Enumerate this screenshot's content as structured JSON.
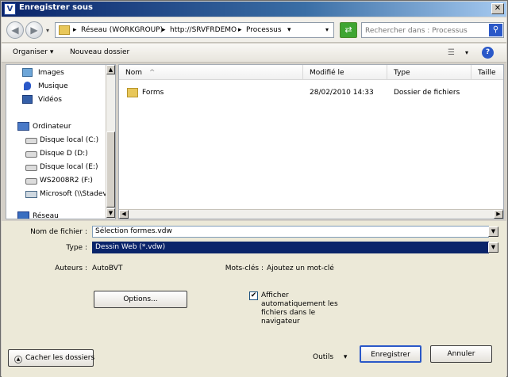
{
  "window": {
    "title": "Enregistrer sous",
    "app_icon_letter": "V",
    "close_label": "✕"
  },
  "nav": {
    "back_label": "◀",
    "forward_label": "▶",
    "history_dropdown": "▾",
    "breadcrumb": [
      "Réseau (WORKGROUP)",
      "http://SRVFRDEMO",
      "Processus"
    ],
    "breadcrumb_sep": "▸",
    "address_dropdown": "▾",
    "refresh_label": "⇄",
    "search_placeholder": "Rechercher dans : Processus",
    "search_icon": "⚲"
  },
  "toolbar": {
    "organize_label": "Organiser",
    "organize_dropdown": "▾",
    "new_folder_label": "Nouveau dossier",
    "views_icon": "☰",
    "views_dropdown": "▾",
    "help_label": "?"
  },
  "navpane": {
    "items": [
      {
        "label": "Images",
        "icon": "images-icon"
      },
      {
        "label": "Musique",
        "icon": "music-icon"
      },
      {
        "label": "Vidéos",
        "icon": "videos-icon"
      },
      {
        "label": "Ordinateur",
        "icon": "computer-icon"
      },
      {
        "label": "Disque local (C:)",
        "icon": "drive-icon"
      },
      {
        "label": "Disque D (D:)",
        "icon": "drive-icon"
      },
      {
        "label": "Disque local (E:)",
        "icon": "drive-icon"
      },
      {
        "label": "WS2008R2 (F:)",
        "icon": "drive-icon"
      },
      {
        "label": "Microsoft (\\\\Stadev",
        "icon": "network-drive-icon"
      },
      {
        "label": "Réseau",
        "icon": "network-icon"
      }
    ],
    "scroll_up": "▲",
    "scroll_down": "▼"
  },
  "files": {
    "columns": [
      "Nom",
      "Modifié le",
      "Type",
      "Taille"
    ],
    "sort_indicator": "^",
    "rows": [
      {
        "name": "Forms",
        "modified": "28/02/2010 14:33",
        "type": "Dossier de fichiers",
        "size": ""
      }
    ],
    "scroll_left": "◀",
    "scroll_right": "▶"
  },
  "form": {
    "filename_label": "Nom de fichier :",
    "filename_value": "Sélection formes.vdw",
    "type_label": "Type :",
    "type_value": "Dessin Web (*.vdw)",
    "dropdown_arrow": "▼",
    "authors_label": "Auteurs :",
    "authors_value": "AutoBVT",
    "keywords_label": "Mots-clés :",
    "keywords_value": "Ajoutez un mot-clé",
    "options_label": "Options...",
    "checkbox_label": "Afficher automatiquement les fichiers dans le navigateur",
    "checkbox_checked": true,
    "checkbox_mark": "✔",
    "hide_folders_label": "Cacher les dossiers",
    "hide_folders_icon": "▲",
    "tools_label": "Outils",
    "tools_dropdown": "▾",
    "save_label": "Enregistrer",
    "cancel_label": "Annuler"
  }
}
